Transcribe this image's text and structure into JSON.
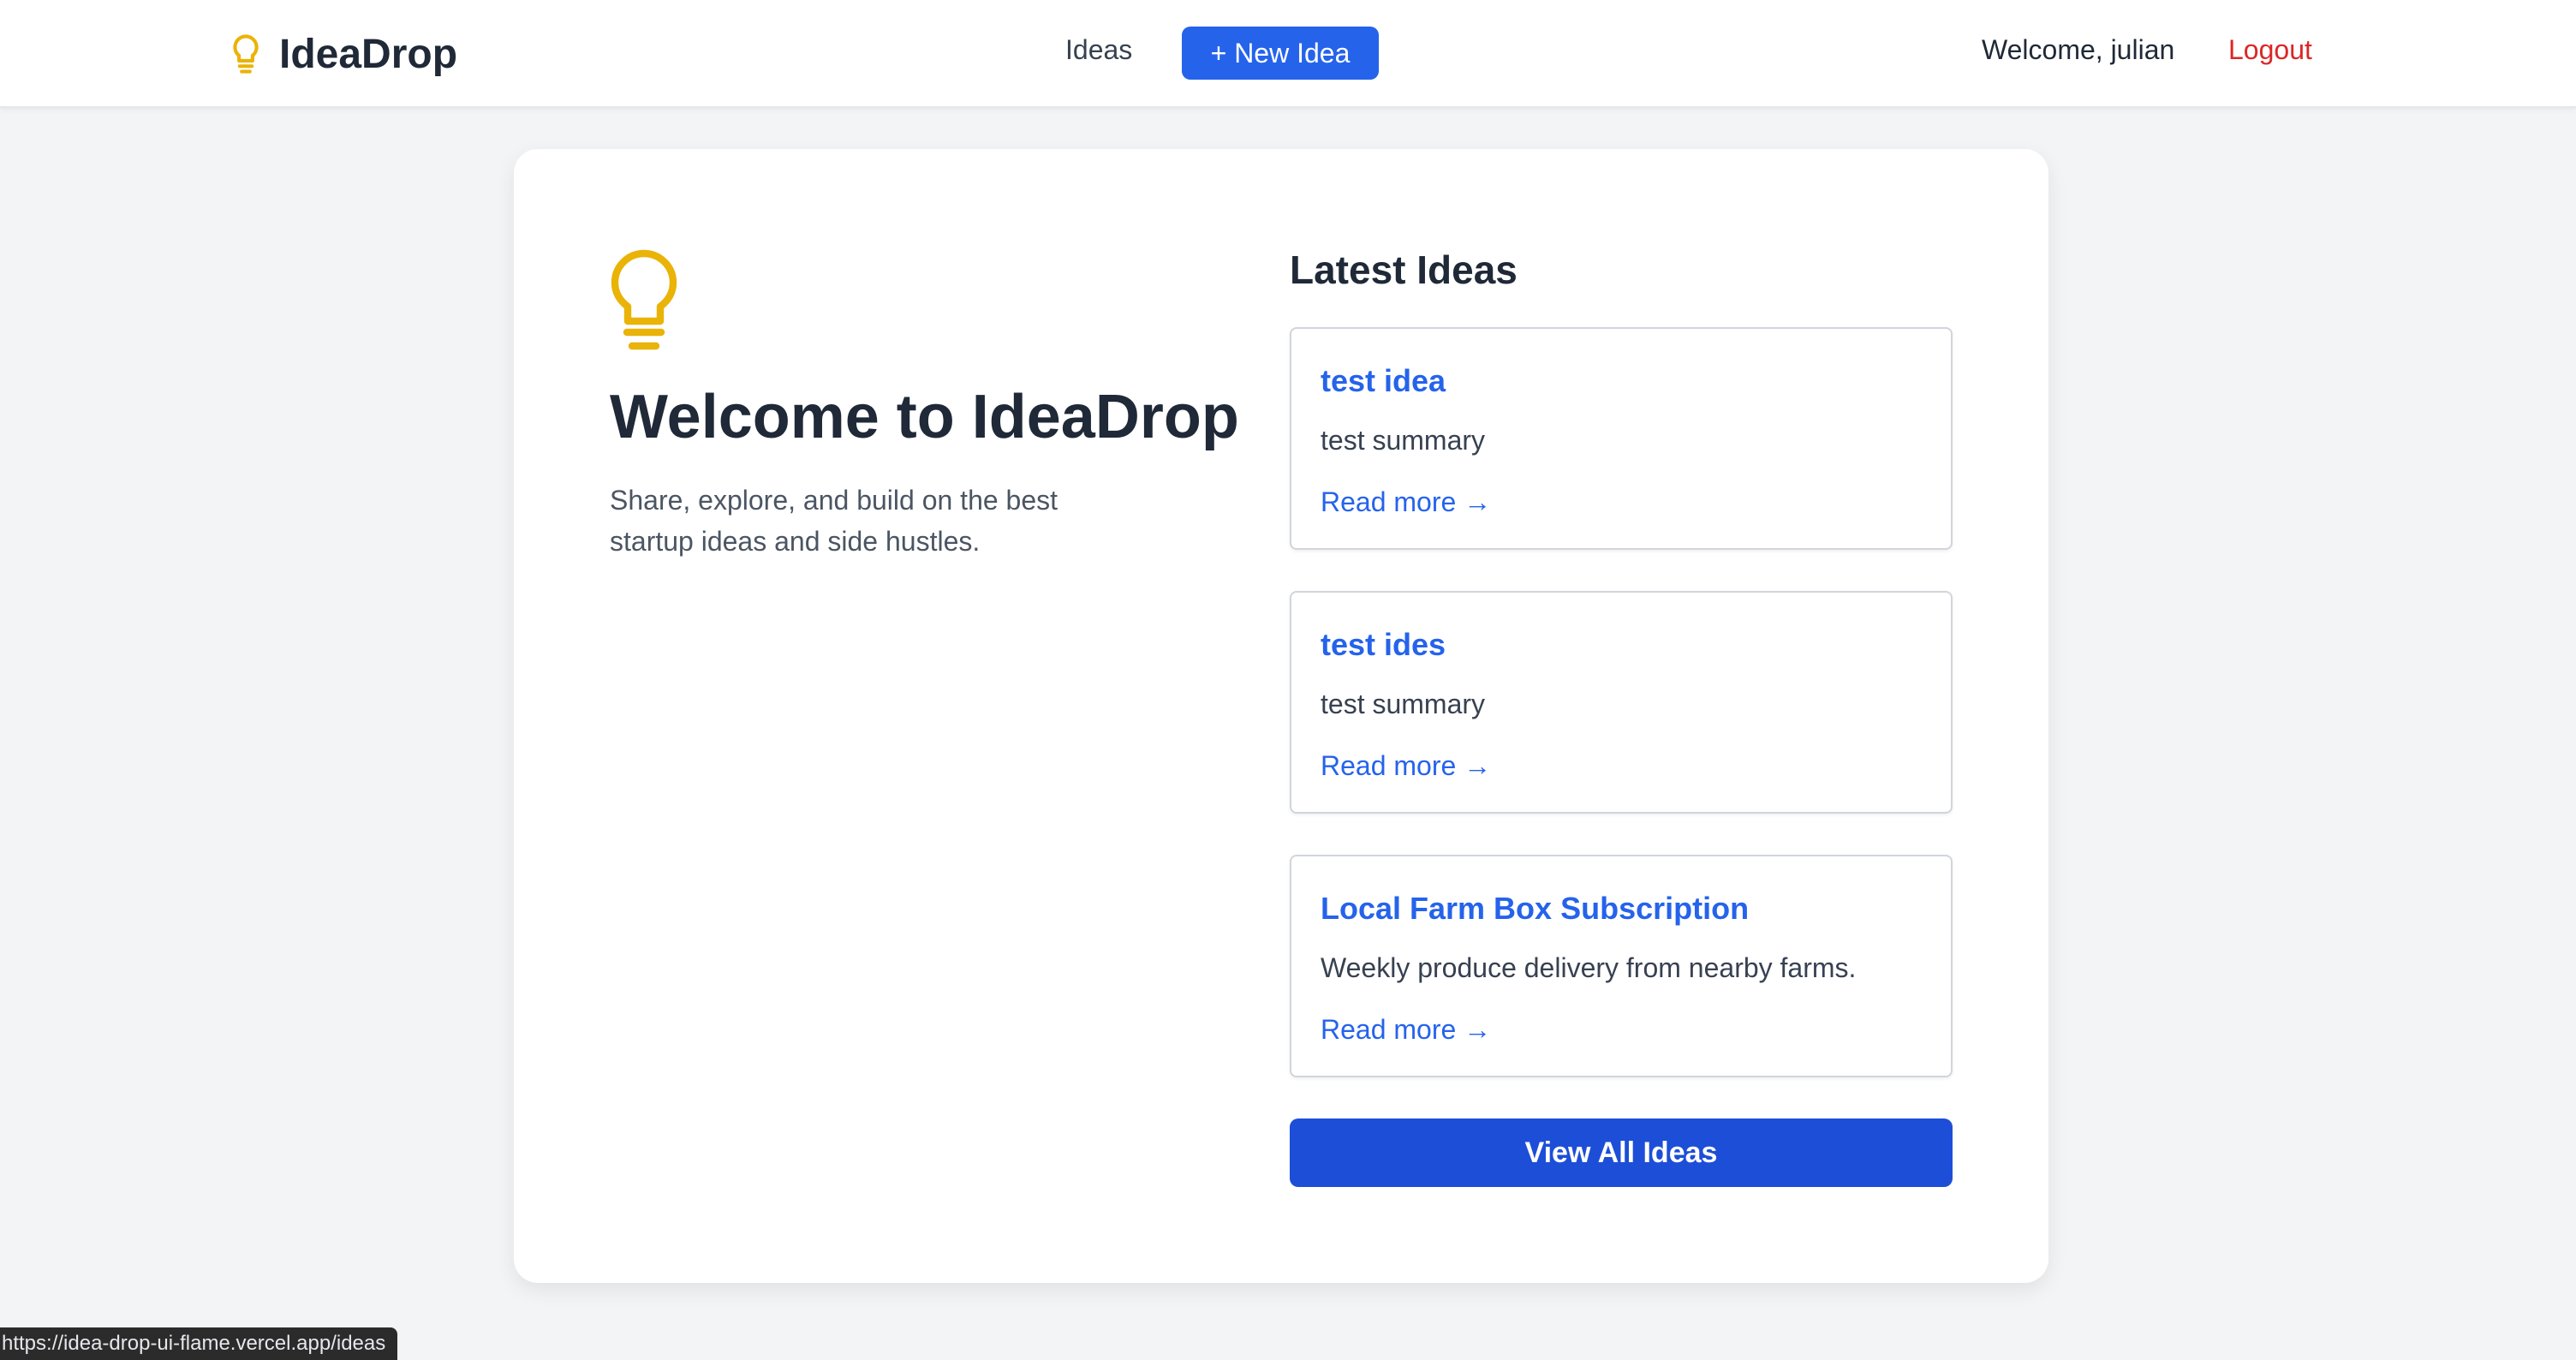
{
  "header": {
    "brand": "IdeaDrop",
    "brand_icon": "lightbulb-icon",
    "nav_ideas": "Ideas",
    "new_idea_label": "+ New Idea",
    "welcome_text": "Welcome, julian",
    "logout_label": "Logout"
  },
  "hero": {
    "icon": "lightbulb-icon",
    "title": "Welcome to IdeaDrop",
    "description_line1": "Share, explore, and build on the best",
    "description_line2": "startup ideas and side hustles."
  },
  "latest": {
    "title": "Latest Ideas",
    "ideas": [
      {
        "title": "test idea",
        "summary": "test summary",
        "read_more": "Read more →"
      },
      {
        "title": "test ides",
        "summary": "test summary",
        "read_more": "Read more →"
      },
      {
        "title": "Local Farm Box Subscription",
        "summary": "Weekly produce delivery from nearby farms.",
        "read_more": "Read more →"
      }
    ],
    "view_all_label": "View All Ideas"
  },
  "status_bar": {
    "url": "https://idea-drop-ui-flame.vercel.app/ideas"
  },
  "colors": {
    "primary": "#2563eb",
    "primary_dark": "#1d4ed8",
    "logout": "#dc2626",
    "bulb": "#eab308",
    "background": "#f3f4f6"
  }
}
